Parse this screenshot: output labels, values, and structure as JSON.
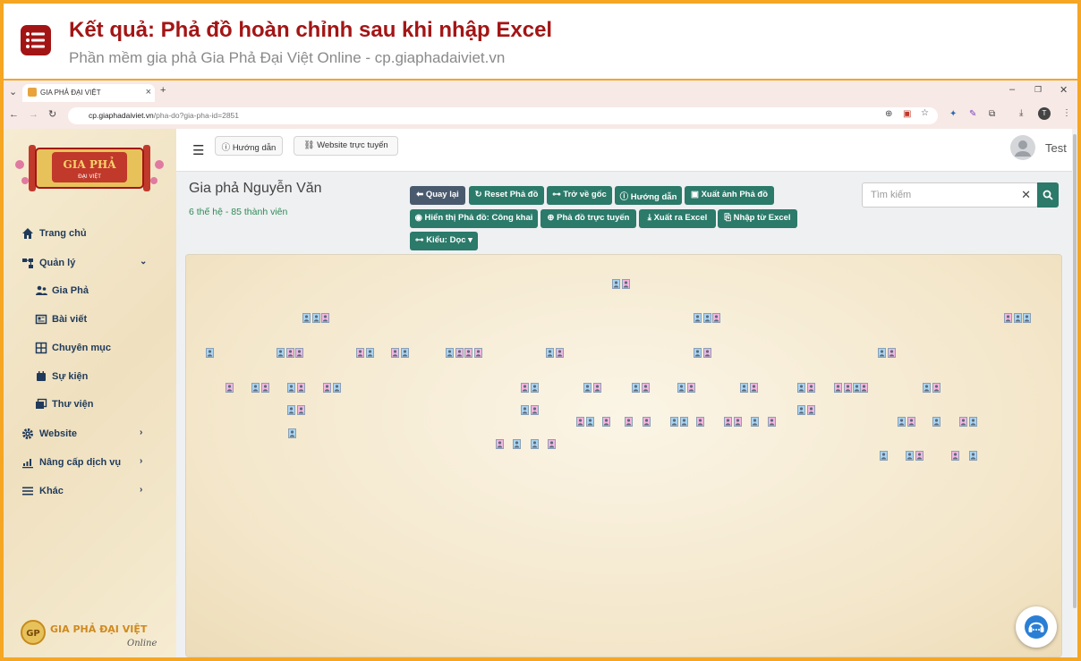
{
  "header": {
    "title": "Kết quả: Phả đồ hoàn chỉnh sau khi nhập Excel",
    "subtitle": "Phần mềm gia phả Gia Phả Đại Việt Online - cp.giaphadaiviet.vn"
  },
  "browser": {
    "tab_title": "GIA PHẢ ĐẠI VIỆT",
    "url_host": "cp.giaphadaiviet.vn",
    "url_path": "/pha-do?gia-pha-id=2851"
  },
  "sidebar": {
    "logo_text": "GIA PHẢ",
    "logo_sub": "ĐẠI VIỆT",
    "items": [
      {
        "label": "Trang chủ",
        "icon": "home-icon",
        "chev": ""
      },
      {
        "label": "Quản lý",
        "icon": "sitemap-icon",
        "chev": "⌄"
      },
      {
        "label": "Gia Phả",
        "icon": "users-icon",
        "chev": ""
      },
      {
        "label": "Bài viết",
        "icon": "newspaper-icon",
        "chev": ""
      },
      {
        "label": "Chuyên mục",
        "icon": "grid-icon",
        "chev": ""
      },
      {
        "label": "Sự kiện",
        "icon": "calendar-icon",
        "chev": ""
      },
      {
        "label": "Thư viện",
        "icon": "images-icon",
        "chev": ""
      },
      {
        "label": "Website",
        "icon": "gear-icon",
        "chev": "›"
      },
      {
        "label": "Nâng cấp dịch vụ",
        "icon": "chart-icon",
        "chev": "›"
      },
      {
        "label": "Khác",
        "icon": "list-icon",
        "chev": "›"
      }
    ],
    "footer_logo": "GIA PHẢ ĐẠI VIỆT",
    "footer_sub": "Online"
  },
  "topbar": {
    "guide_label": "Hướng dẫn",
    "website_label": "Website trực tuyến",
    "user_name": "Test"
  },
  "genealogy": {
    "title": "Gia phả Nguyễn Văn",
    "summary": "6 thế hệ - 85 thành viên"
  },
  "actions": {
    "back": "Quay lại",
    "reset": "Reset Phả đồ",
    "root": "Trở về gốc",
    "guide": "Hướng dẫn",
    "export_image": "Xuất ảnh Phả đồ",
    "display": "Hiển thị Phả đồ: Công khai",
    "online": "Phả đồ trực tuyến",
    "export_excel": "Xuất ra Excel",
    "import_excel": "Nhập từ Excel",
    "style": "Kiểu: Dọc"
  },
  "search": {
    "placeholder": "Tìm kiếm"
  },
  "colors": {
    "male": "#a9d4f2",
    "female": "#f4b6e0",
    "accent": "#2b7a6a",
    "brand": "#a31515"
  }
}
